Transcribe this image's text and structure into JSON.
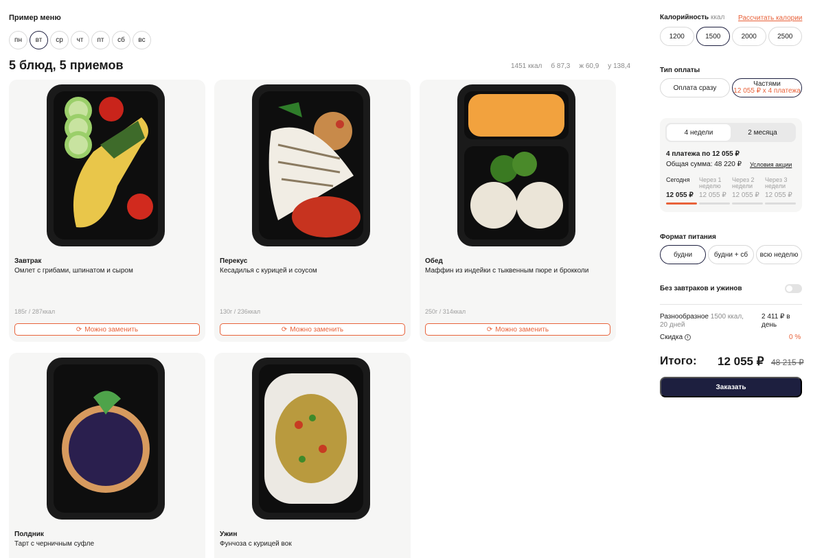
{
  "menu": {
    "label": "Пример меню",
    "days": [
      "пн",
      "вт",
      "ср",
      "чт",
      "пт",
      "сб",
      "вс"
    ],
    "active_day": "вт",
    "title": "5 блюд, 5 приемов",
    "macros": {
      "kcal": "1451 ккал",
      "protein": "б 87,3",
      "fat": "ж 60,9",
      "carbs": "у 138,4"
    }
  },
  "swap_label": "Можно заменить",
  "cards": [
    {
      "category": "Завтрак",
      "name": "Омлет с грибами, шпинатом и сыром",
      "meta": "185г / 287ккал"
    },
    {
      "category": "Перекус",
      "name": "Кесадилья с курицей и соусом",
      "meta": "130г / 236ккал"
    },
    {
      "category": "Обед",
      "name": "Маффин из индейки с тыквенным пюре и брокколи",
      "meta": "250г / 314ккал"
    },
    {
      "category": "Полдник",
      "name": "Тарт с черничным суфле"
    },
    {
      "category": "Ужин",
      "name": "Фунчоза с курицей вок"
    }
  ],
  "sidebar": {
    "calories": {
      "label": "Калорийность",
      "unit": "ккал",
      "link": "Рассчитать калории",
      "options": [
        "1200",
        "1500",
        "2000",
        "2500"
      ],
      "selected": "1500"
    },
    "payment": {
      "label": "Тип оплаты",
      "full": "Оплата сразу",
      "parts": "Частями",
      "parts_sub": "12 055 ₽ x 4 платежа"
    },
    "plan": {
      "tabs": [
        "4 недели",
        "2 месяца"
      ],
      "title": "4 платежа по 12 055 ₽",
      "total": "Общая сумма: 48 220 ₽",
      "terms": "Условия акции",
      "schedule": [
        {
          "when": "Сегодня",
          "amount": "12 055 ₽"
        },
        {
          "when": "Через 1 неделю",
          "amount": "12 055 ₽"
        },
        {
          "when": "Через 2 недели",
          "amount": "12 055 ₽"
        },
        {
          "when": "Через 3 недели",
          "amount": "12 055 ₽"
        }
      ]
    },
    "format": {
      "label": "Формат питания",
      "options": [
        "будни",
        "будни + сб",
        "всю неделю"
      ],
      "selected": "будни"
    },
    "no_breakfast": "Без завтраков и ужинов",
    "summary": {
      "plan_name": "Разнообразное",
      "plan_kcal": "1500 ккал,",
      "days": "20 дней",
      "per_day": "2 411 ₽ в день",
      "discount_label": "Скидка",
      "discount_value": "0 %"
    },
    "total": {
      "label": "Итого:",
      "price": "12 055 ₽",
      "old": "48 215 ₽"
    },
    "order": "Заказать"
  },
  "colors": {
    "accent": "#e8623a",
    "navy": "#1d1f3f",
    "card": "#f6f6f5"
  }
}
